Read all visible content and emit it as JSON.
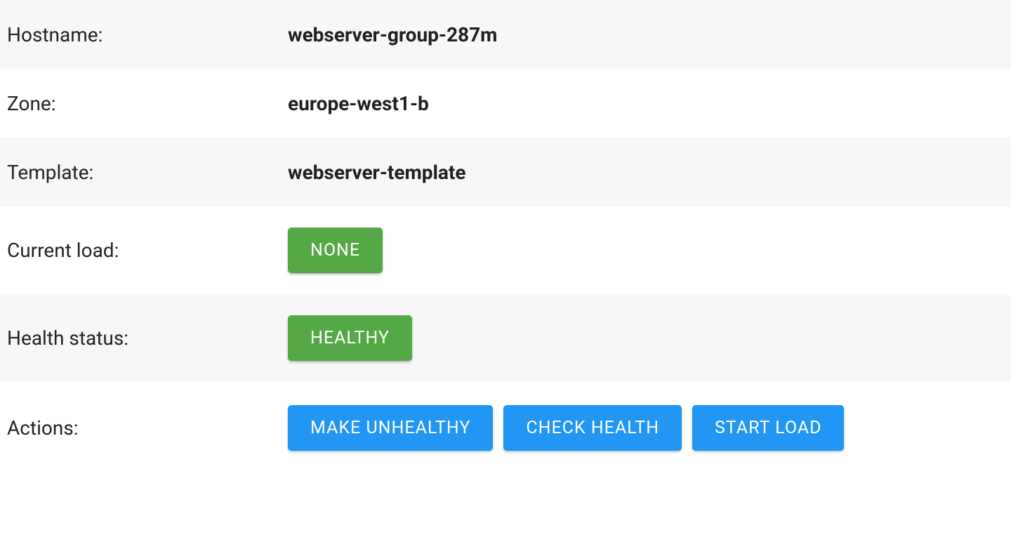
{
  "rows": {
    "hostname": {
      "label": "Hostname:",
      "value": "webserver-group-287m"
    },
    "zone": {
      "label": "Zone:",
      "value": "europe-west1-b"
    },
    "template": {
      "label": "Template:",
      "value": "webserver-template"
    },
    "load": {
      "label": "Current load:",
      "badge": "NONE"
    },
    "health": {
      "label": "Health status:",
      "badge": "HEALTHY"
    },
    "actions": {
      "label": "Actions:",
      "buttons": {
        "make_unhealthy": "MAKE UNHEALTHY",
        "check_health": "CHECK HEALTH",
        "start_load": "START LOAD"
      }
    }
  },
  "colors": {
    "badge_green": "#55a846",
    "action_blue": "#2196F3",
    "row_odd_bg": "#f7f7f7"
  }
}
